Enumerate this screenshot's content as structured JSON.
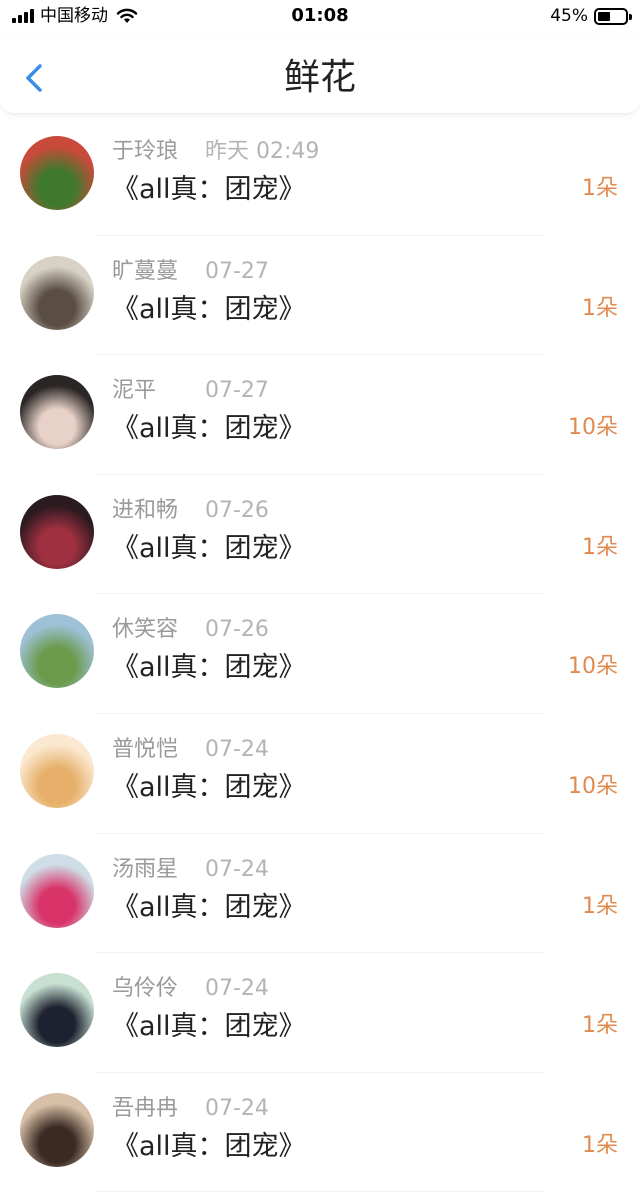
{
  "status_bar": {
    "carrier": "中国移动",
    "time": "01:08",
    "battery_percent": "45%",
    "battery_level": 0.45
  },
  "nav": {
    "title": "鲜花",
    "back_icon": "chevron-left-icon"
  },
  "colors": {
    "accent_blue": "#3b8ee8",
    "count_orange": "#e08a4f"
  },
  "items": [
    {
      "name": "于玲琅",
      "date": "昨天 02:49",
      "book": "《all真：团宠》",
      "count": "1朵",
      "avatar_colors": [
        "#c94a3a",
        "#3f7a2c"
      ]
    },
    {
      "name": "旷蔓蔓",
      "date": "07-27",
      "book": "《all真：团宠》",
      "count": "1朵",
      "avatar_colors": [
        "#d8d2c6",
        "#5a4e44"
      ]
    },
    {
      "name": "泥平",
      "date": "07-27",
      "book": "《all真：团宠》",
      "count": "10朵",
      "avatar_colors": [
        "#2a2626",
        "#e8d2c8"
      ]
    },
    {
      "name": "进和畅",
      "date": "07-26",
      "book": "《all真：团宠》",
      "count": "1朵",
      "avatar_colors": [
        "#2b1a20",
        "#a03040"
      ]
    },
    {
      "name": "休笑容",
      "date": "07-26",
      "book": "《all真：团宠》",
      "count": "10朵",
      "avatar_colors": [
        "#9fc1d8",
        "#6a9a4a"
      ]
    },
    {
      "name": "普悦恺",
      "date": "07-24",
      "book": "《all真：团宠》",
      "count": "10朵",
      "avatar_colors": [
        "#fbe8d0",
        "#e6b06a"
      ]
    },
    {
      "name": "汤雨星",
      "date": "07-24",
      "book": "《all真：团宠》",
      "count": "1朵",
      "avatar_colors": [
        "#cfdde6",
        "#d8346a"
      ]
    },
    {
      "name": "乌伶伶",
      "date": "07-24",
      "book": "《all真：团宠》",
      "count": "1朵",
      "avatar_colors": [
        "#c7e0d2",
        "#1e2230"
      ]
    },
    {
      "name": "吾冉冉",
      "date": "07-24",
      "book": "《all真：团宠》",
      "count": "1朵",
      "avatar_colors": [
        "#d8c0a8",
        "#3a2a22"
      ]
    }
  ]
}
